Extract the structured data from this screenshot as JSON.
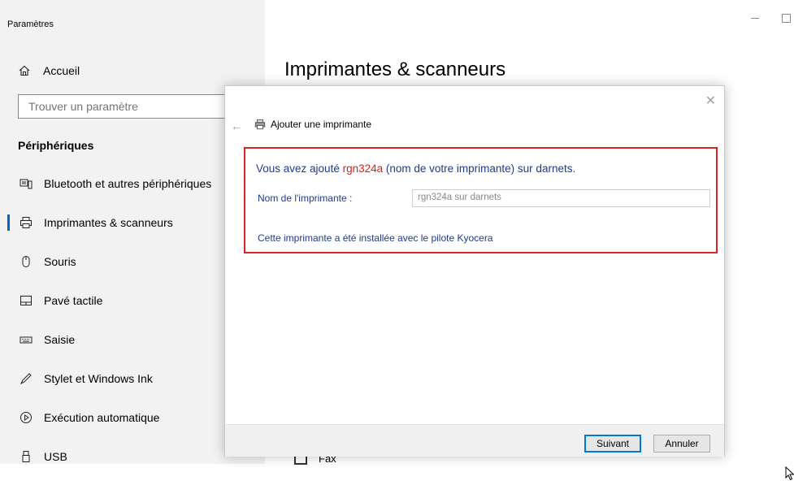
{
  "window": {
    "title": "Paramètres"
  },
  "sidebar": {
    "home_label": "Accueil",
    "search_placeholder": "Trouver un paramètre",
    "section_title": "Périphériques",
    "items": [
      {
        "label": "Bluetooth et autres périphériques",
        "icon": "bluetooth-devices-icon"
      },
      {
        "label": "Imprimantes & scanneurs",
        "icon": "printer-icon",
        "active": true
      },
      {
        "label": "Souris",
        "icon": "mouse-icon"
      },
      {
        "label": "Pavé tactile",
        "icon": "touchpad-icon"
      },
      {
        "label": "Saisie",
        "icon": "keyboard-icon"
      },
      {
        "label": "Stylet et Windows Ink",
        "icon": "pen-icon"
      },
      {
        "label": "Exécution automatique",
        "icon": "autoplay-icon"
      },
      {
        "label": "USB",
        "icon": "usb-icon"
      }
    ]
  },
  "content": {
    "page_title": "Imprimantes & scanneurs",
    "partial_item": "Fax"
  },
  "dialog": {
    "header_title": "Ajouter une imprimante",
    "message_prefix": "Vous avez ajouté ",
    "printer_name_highlight": "rgn324a",
    "message_suffix": " (nom de votre imprimante) sur darnets.",
    "name_label": "Nom de l'imprimante :",
    "name_value": "rgn324a sur darnets",
    "driver_message": "Cette imprimante a été installée avec le pilote Kyocera",
    "next_label": "Suivant",
    "cancel_label": "Annuler"
  },
  "colors": {
    "accent": "#0067c0",
    "highlight_border": "#d32626",
    "printer_name": "#e21b1b",
    "dialog_text": "#1f3a93"
  }
}
